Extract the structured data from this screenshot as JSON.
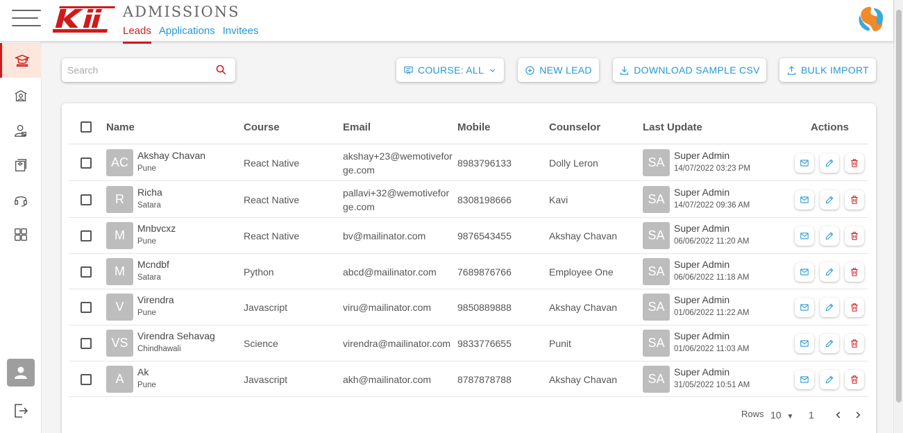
{
  "app": {
    "title": "ADMISSIONS",
    "logo_text": "KII",
    "accent_color": "#d11a1a",
    "link_color": "#2497d8"
  },
  "tabs": [
    {
      "label": "Leads",
      "active": true
    },
    {
      "label": "Applications",
      "active": false
    },
    {
      "label": "Invitees",
      "active": false
    }
  ],
  "sidebar": {
    "items": [
      {
        "icon": "graduation-icon",
        "active": true
      },
      {
        "icon": "school-building-icon",
        "active": false
      },
      {
        "icon": "user-badge-icon",
        "active": false
      },
      {
        "icon": "course-book-icon",
        "active": false
      },
      {
        "icon": "headset-icon",
        "active": false
      },
      {
        "icon": "dashboard-grid-icon",
        "active": false
      }
    ],
    "profile_icon": "person-icon",
    "logout_icon": "logout-icon"
  },
  "search": {
    "placeholder": "Search",
    "value": ""
  },
  "toolbar": {
    "course_filter": "COURSE: ALL",
    "new_lead": "NEW LEAD",
    "download_csv": "DOWNLOAD SAMPLE CSV",
    "bulk_import": "BULK IMPORT"
  },
  "table": {
    "columns": [
      "Name",
      "Course",
      "Email",
      "Mobile",
      "Counselor",
      "Last Update",
      "Actions"
    ],
    "rows": [
      {
        "initials": "AC",
        "name": "Akshay Chavan",
        "city": "Pune",
        "course": "React Native",
        "email": "akshay+23@wemotiveforge.com",
        "mobile": "8983796133",
        "counselor": "Dolly Leron",
        "upd_initials": "SA",
        "upd_by": "Super Admin",
        "upd_at": "14/07/2022 03:23 PM"
      },
      {
        "initials": "R",
        "name": "Richa",
        "city": "Satara",
        "course": "React Native",
        "email": "pallavi+32@wemotiveforge.com",
        "mobile": "8308198666",
        "counselor": "Kavi",
        "upd_initials": "SA",
        "upd_by": "Super Admin",
        "upd_at": "14/07/2022 09:36 AM"
      },
      {
        "initials": "M",
        "name": "Mnbvcxz",
        "city": "Pune",
        "course": "React Native",
        "email": "bv@mailinator.com",
        "mobile": "9876543455",
        "counselor": "Akshay Chavan",
        "upd_initials": "SA",
        "upd_by": "Super Admin",
        "upd_at": "06/06/2022 11:20 AM"
      },
      {
        "initials": "M",
        "name": "Mcndbf",
        "city": "Satara",
        "course": "Python",
        "email": "abcd@mailinator.com",
        "mobile": "7689876766",
        "counselor": "Employee One",
        "upd_initials": "SA",
        "upd_by": "Super Admin",
        "upd_at": "06/06/2022 11:18 AM"
      },
      {
        "initials": "V",
        "name": "Virendra",
        "city": "Pune",
        "course": "Javascript",
        "email": "viru@mailinator.com",
        "mobile": "9850889888",
        "counselor": "Akshay Chavan",
        "upd_initials": "SA",
        "upd_by": "Super Admin",
        "upd_at": "01/06/2022 11:22 AM"
      },
      {
        "initials": "VS",
        "name": "Virendra Sehavag",
        "city": "Chindhawali",
        "course": "Science",
        "email": "virendra@mailinator.com",
        "mobile": "9833776655",
        "counselor": "Punit",
        "upd_initials": "SA",
        "upd_by": "Super Admin",
        "upd_at": "01/06/2022 11:03 AM"
      },
      {
        "initials": "A",
        "name": "Ak",
        "city": "Pune",
        "course": "Javascript",
        "email": "akh@mailinator.com",
        "mobile": "8787878788",
        "counselor": "Akshay Chavan",
        "upd_initials": "SA",
        "upd_by": "Super Admin",
        "upd_at": "31/05/2022 10:51 AM"
      }
    ]
  },
  "pagination": {
    "rows_label": "Rows",
    "rows_per_page": "10",
    "page": "1"
  }
}
